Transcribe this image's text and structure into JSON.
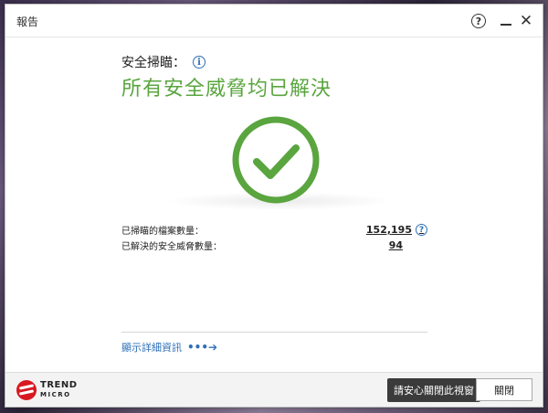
{
  "window": {
    "title": "報告"
  },
  "titlebar": {
    "help_icon": "help-icon",
    "minimize_icon": "minimize-icon",
    "close_glyph": "✕"
  },
  "scan": {
    "label": "安全掃瞄：",
    "info_icon_glyph": "i",
    "status": "所有安全威脅均已解決"
  },
  "stats": [
    {
      "label": "已掃瞄的檔案數量：",
      "value": "152,195"
    },
    {
      "label": "已解決的安全威脅數量：",
      "value": "94"
    }
  ],
  "details_link": {
    "label": "顯示詳細資訊",
    "arrow": "•••➔"
  },
  "footer": {
    "logo_line1": "TREND",
    "logo_line2": "MICRO",
    "tooltip": "請安心關閉此視窗",
    "close_label": "關閉"
  },
  "colors": {
    "accent_green": "#5aa53f",
    "link_blue": "#2e6fb7",
    "brand_red": "#d71920"
  }
}
